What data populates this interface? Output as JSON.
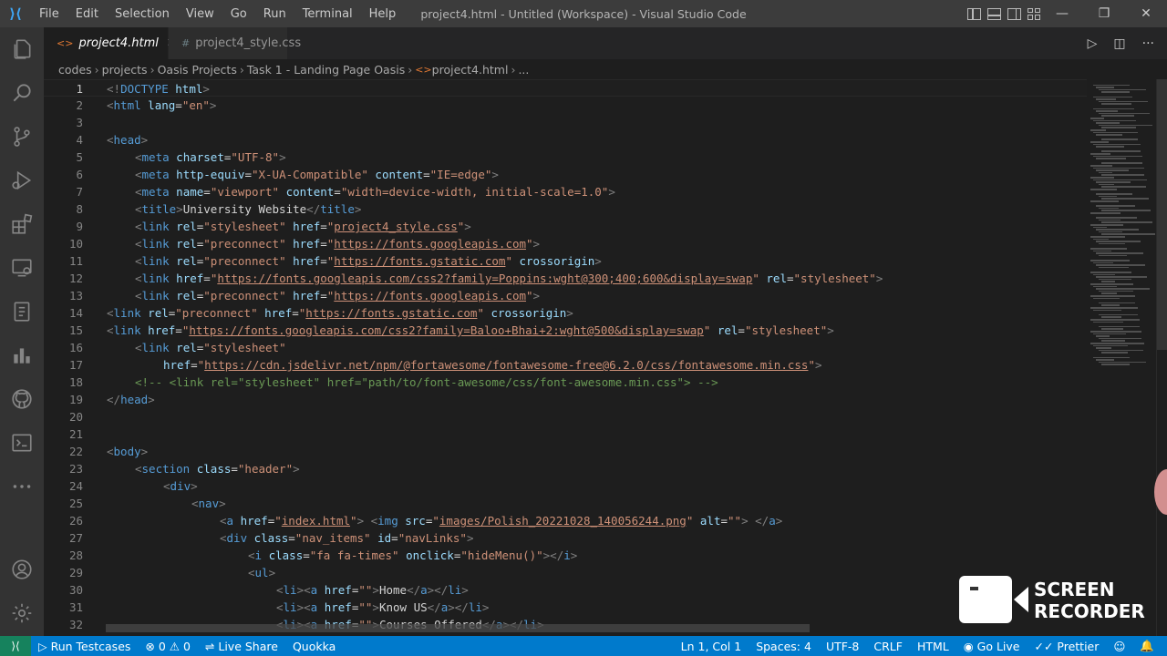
{
  "window": {
    "title": "project4.html - Untitled (Workspace) - Visual Studio Code",
    "menu": [
      "File",
      "Edit",
      "Selection",
      "View",
      "Go",
      "Run",
      "Terminal",
      "Help"
    ]
  },
  "tabs": [
    {
      "label": "project4.html",
      "icon": "<>",
      "active": true
    },
    {
      "label": "project4_style.css",
      "icon": "#",
      "active": false
    }
  ],
  "breadcrumb": [
    "codes",
    "projects",
    "Oasis Projects",
    "Task 1 - Landing Page Oasis",
    "project4.html",
    "..."
  ],
  "editor": {
    "current_line": 1,
    "lines": [
      {
        "n": "1",
        "indent": 0,
        "t": [
          [
            "p",
            "<!"
          ],
          [
            "g",
            "DOCTYPE"
          ],
          [
            "a",
            " html"
          ],
          [
            "p",
            ">"
          ]
        ]
      },
      {
        "n": "2",
        "indent": 0,
        "t": [
          [
            "p",
            "<"
          ],
          [
            "g",
            "html"
          ],
          [
            "a",
            " lang"
          ],
          [
            "x",
            "="
          ],
          [
            "s",
            "\"en\""
          ],
          [
            "p",
            ">"
          ]
        ]
      },
      {
        "n": "3",
        "indent": 0,
        "t": []
      },
      {
        "n": "4",
        "indent": 0,
        "t": [
          [
            "p",
            "<"
          ],
          [
            "g",
            "head"
          ],
          [
            "p",
            ">"
          ]
        ]
      },
      {
        "n": "5",
        "indent": 1,
        "t": [
          [
            "p",
            "<"
          ],
          [
            "g",
            "meta"
          ],
          [
            "a",
            " charset"
          ],
          [
            "x",
            "="
          ],
          [
            "s",
            "\"UTF-8\""
          ],
          [
            "p",
            ">"
          ]
        ]
      },
      {
        "n": "6",
        "indent": 1,
        "t": [
          [
            "p",
            "<"
          ],
          [
            "g",
            "meta"
          ],
          [
            "a",
            " http-equiv"
          ],
          [
            "x",
            "="
          ],
          [
            "s",
            "\"X-UA-Compatible\""
          ],
          [
            "a",
            " content"
          ],
          [
            "x",
            "="
          ],
          [
            "s",
            "\"IE=edge\""
          ],
          [
            "p",
            ">"
          ]
        ]
      },
      {
        "n": "7",
        "indent": 1,
        "t": [
          [
            "p",
            "<"
          ],
          [
            "g",
            "meta"
          ],
          [
            "a",
            " name"
          ],
          [
            "x",
            "="
          ],
          [
            "s",
            "\"viewport\""
          ],
          [
            "a",
            " content"
          ],
          [
            "x",
            "="
          ],
          [
            "s",
            "\"width=device-width, initial-scale=1.0\""
          ],
          [
            "p",
            ">"
          ]
        ]
      },
      {
        "n": "8",
        "indent": 1,
        "t": [
          [
            "p",
            "<"
          ],
          [
            "g",
            "title"
          ],
          [
            "p",
            ">"
          ],
          [
            "x",
            "University Website"
          ],
          [
            "p",
            "</"
          ],
          [
            "g",
            "title"
          ],
          [
            "p",
            ">"
          ]
        ]
      },
      {
        "n": "9",
        "indent": 1,
        "t": [
          [
            "p",
            "<"
          ],
          [
            "g",
            "link"
          ],
          [
            "a",
            " rel"
          ],
          [
            "x",
            "="
          ],
          [
            "s",
            "\"stylesheet\""
          ],
          [
            "a",
            " href"
          ],
          [
            "x",
            "="
          ],
          [
            "s",
            "\""
          ],
          [
            "l",
            "project4_style.css"
          ],
          [
            "s",
            "\""
          ],
          [
            "p",
            ">"
          ]
        ]
      },
      {
        "n": "10",
        "indent": 1,
        "t": [
          [
            "p",
            "<"
          ],
          [
            "g",
            "link"
          ],
          [
            "a",
            " rel"
          ],
          [
            "x",
            "="
          ],
          [
            "s",
            "\"preconnect\""
          ],
          [
            "a",
            " href"
          ],
          [
            "x",
            "="
          ],
          [
            "s",
            "\""
          ],
          [
            "l",
            "https://fonts.googleapis.com"
          ],
          [
            "s",
            "\""
          ],
          [
            "p",
            ">"
          ]
        ]
      },
      {
        "n": "11",
        "indent": 1,
        "t": [
          [
            "p",
            "<"
          ],
          [
            "g",
            "link"
          ],
          [
            "a",
            " rel"
          ],
          [
            "x",
            "="
          ],
          [
            "s",
            "\"preconnect\""
          ],
          [
            "a",
            " href"
          ],
          [
            "x",
            "="
          ],
          [
            "s",
            "\""
          ],
          [
            "l",
            "https://fonts.gstatic.com"
          ],
          [
            "s",
            "\""
          ],
          [
            "a",
            " crossorigin"
          ],
          [
            "p",
            ">"
          ]
        ]
      },
      {
        "n": "12",
        "indent": 1,
        "t": [
          [
            "p",
            "<"
          ],
          [
            "g",
            "link"
          ],
          [
            "a",
            " href"
          ],
          [
            "x",
            "="
          ],
          [
            "s",
            "\""
          ],
          [
            "l",
            "https://fonts.googleapis.com/css2?family=Poppins:wght@300;400;600&display=swap"
          ],
          [
            "s",
            "\""
          ],
          [
            "a",
            " rel"
          ],
          [
            "x",
            "="
          ],
          [
            "s",
            "\"stylesheet\""
          ],
          [
            "p",
            ">"
          ]
        ]
      },
      {
        "n": "13",
        "indent": 1,
        "t": [
          [
            "p",
            "<"
          ],
          [
            "g",
            "link"
          ],
          [
            "a",
            " rel"
          ],
          [
            "x",
            "="
          ],
          [
            "s",
            "\"preconnect\""
          ],
          [
            "a",
            " href"
          ],
          [
            "x",
            "="
          ],
          [
            "s",
            "\""
          ],
          [
            "l",
            "https://fonts.googleapis.com"
          ],
          [
            "s",
            "\""
          ],
          [
            "p",
            ">"
          ]
        ]
      },
      {
        "n": "14",
        "indent": 0,
        "t": [
          [
            "p",
            "<"
          ],
          [
            "g",
            "link"
          ],
          [
            "a",
            " rel"
          ],
          [
            "x",
            "="
          ],
          [
            "s",
            "\"preconnect\""
          ],
          [
            "a",
            " href"
          ],
          [
            "x",
            "="
          ],
          [
            "s",
            "\""
          ],
          [
            "l",
            "https://fonts.gstatic.com"
          ],
          [
            "s",
            "\""
          ],
          [
            "a",
            " crossorigin"
          ],
          [
            "p",
            ">"
          ]
        ]
      },
      {
        "n": "15",
        "indent": 0,
        "t": [
          [
            "p",
            "<"
          ],
          [
            "g",
            "link"
          ],
          [
            "a",
            " href"
          ],
          [
            "x",
            "="
          ],
          [
            "s",
            "\""
          ],
          [
            "l",
            "https://fonts.googleapis.com/css2?family=Baloo+Bhai+2:wght@500&display=swap"
          ],
          [
            "s",
            "\""
          ],
          [
            "a",
            " rel"
          ],
          [
            "x",
            "="
          ],
          [
            "s",
            "\"stylesheet\""
          ],
          [
            "p",
            ">"
          ]
        ]
      },
      {
        "n": "16",
        "indent": 1,
        "t": [
          [
            "p",
            "<"
          ],
          [
            "g",
            "link"
          ],
          [
            "a",
            " rel"
          ],
          [
            "x",
            "="
          ],
          [
            "s",
            "\"stylesheet\""
          ]
        ]
      },
      {
        "n": "17",
        "indent": 2,
        "t": [
          [
            "a",
            "href"
          ],
          [
            "x",
            "="
          ],
          [
            "s",
            "\""
          ],
          [
            "l",
            "https://cdn.jsdelivr.net/npm/@fortawesome/fontawesome-free@6.2.0/css/fontawesome.min.css"
          ],
          [
            "s",
            "\""
          ],
          [
            "p",
            ">"
          ]
        ]
      },
      {
        "n": "18",
        "indent": 1,
        "t": [
          [
            "c",
            "<!-- <link rel=\"stylesheet\" href=\"path/to/font-awesome/css/font-awesome.min.css\"> -->"
          ]
        ]
      },
      {
        "n": "19",
        "indent": 0,
        "t": [
          [
            "p",
            "</"
          ],
          [
            "g",
            "head"
          ],
          [
            "p",
            ">"
          ]
        ]
      },
      {
        "n": "20",
        "indent": 0,
        "t": []
      },
      {
        "n": "21",
        "indent": 0,
        "t": []
      },
      {
        "n": "22",
        "indent": 0,
        "t": [
          [
            "p",
            "<"
          ],
          [
            "g",
            "body"
          ],
          [
            "p",
            ">"
          ]
        ]
      },
      {
        "n": "23",
        "indent": 1,
        "t": [
          [
            "p",
            "<"
          ],
          [
            "g",
            "section"
          ],
          [
            "a",
            " class"
          ],
          [
            "x",
            "="
          ],
          [
            "s",
            "\"header\""
          ],
          [
            "p",
            ">"
          ]
        ]
      },
      {
        "n": "24",
        "indent": 2,
        "t": [
          [
            "p",
            "<"
          ],
          [
            "g",
            "div"
          ],
          [
            "p",
            ">"
          ]
        ]
      },
      {
        "n": "25",
        "indent": 3,
        "t": [
          [
            "p",
            "<"
          ],
          [
            "g",
            "nav"
          ],
          [
            "p",
            ">"
          ]
        ]
      },
      {
        "n": "26",
        "indent": 4,
        "t": [
          [
            "p",
            "<"
          ],
          [
            "g",
            "a"
          ],
          [
            "a",
            " href"
          ],
          [
            "x",
            "="
          ],
          [
            "s",
            "\""
          ],
          [
            "l",
            "index.html"
          ],
          [
            "s",
            "\""
          ],
          [
            "p",
            ">"
          ],
          [
            "x",
            " "
          ],
          [
            "p",
            "<"
          ],
          [
            "g",
            "img"
          ],
          [
            "a",
            " src"
          ],
          [
            "x",
            "="
          ],
          [
            "s",
            "\""
          ],
          [
            "l",
            "images/Polish_20221028_140056244.png"
          ],
          [
            "s",
            "\""
          ],
          [
            "a",
            " alt"
          ],
          [
            "x",
            "="
          ],
          [
            "s",
            "\"\""
          ],
          [
            "p",
            ">"
          ],
          [
            "x",
            " "
          ],
          [
            "p",
            "</"
          ],
          [
            "g",
            "a"
          ],
          [
            "p",
            ">"
          ]
        ]
      },
      {
        "n": "27",
        "indent": 4,
        "t": [
          [
            "p",
            "<"
          ],
          [
            "g",
            "div"
          ],
          [
            "a",
            " class"
          ],
          [
            "x",
            "="
          ],
          [
            "s",
            "\"nav_items\""
          ],
          [
            "a",
            " id"
          ],
          [
            "x",
            "="
          ],
          [
            "s",
            "\"navLinks\""
          ],
          [
            "p",
            ">"
          ]
        ]
      },
      {
        "n": "28",
        "indent": 5,
        "t": [
          [
            "p",
            "<"
          ],
          [
            "g",
            "i"
          ],
          [
            "a",
            " class"
          ],
          [
            "x",
            "="
          ],
          [
            "s",
            "\"fa fa-times\""
          ],
          [
            "a",
            " onclick"
          ],
          [
            "x",
            "="
          ],
          [
            "s",
            "\"hideMenu()\""
          ],
          [
            "p",
            "></"
          ],
          [
            "g",
            "i"
          ],
          [
            "p",
            ">"
          ]
        ]
      },
      {
        "n": "29",
        "indent": 5,
        "t": [
          [
            "p",
            "<"
          ],
          [
            "g",
            "ul"
          ],
          [
            "p",
            ">"
          ]
        ]
      },
      {
        "n": "30",
        "indent": 6,
        "t": [
          [
            "p",
            "<"
          ],
          [
            "g",
            "li"
          ],
          [
            "p",
            "><"
          ],
          [
            "g",
            "a"
          ],
          [
            "a",
            " href"
          ],
          [
            "x",
            "="
          ],
          [
            "s",
            "\"\""
          ],
          [
            "p",
            ">"
          ],
          [
            "x",
            "Home"
          ],
          [
            "p",
            "</"
          ],
          [
            "g",
            "a"
          ],
          [
            "p",
            "></"
          ],
          [
            "g",
            "li"
          ],
          [
            "p",
            ">"
          ]
        ]
      },
      {
        "n": "31",
        "indent": 6,
        "t": [
          [
            "p",
            "<"
          ],
          [
            "g",
            "li"
          ],
          [
            "p",
            "><"
          ],
          [
            "g",
            "a"
          ],
          [
            "a",
            " href"
          ],
          [
            "x",
            "="
          ],
          [
            "s",
            "\"\""
          ],
          [
            "p",
            ">"
          ],
          [
            "x",
            "Know US"
          ],
          [
            "p",
            "</"
          ],
          [
            "g",
            "a"
          ],
          [
            "p",
            "></"
          ],
          [
            "g",
            "li"
          ],
          [
            "p",
            ">"
          ]
        ]
      },
      {
        "n": "32",
        "indent": 6,
        "t": [
          [
            "p",
            "<"
          ],
          [
            "g",
            "li"
          ],
          [
            "p",
            "><"
          ],
          [
            "g",
            "a"
          ],
          [
            "a",
            " href"
          ],
          [
            "x",
            "="
          ],
          [
            "s",
            "\"\""
          ],
          [
            "p",
            ">"
          ],
          [
            "x",
            "Courses Offered"
          ],
          [
            "p",
            "</"
          ],
          [
            "g",
            "a"
          ],
          [
            "p",
            "></"
          ],
          [
            "g",
            "li"
          ],
          [
            "p",
            ">"
          ]
        ]
      }
    ]
  },
  "watermark": {
    "line1": "SCREEN",
    "line2": "RECORDER"
  },
  "statusbar": {
    "left": [
      {
        "name": "run-testcases-button",
        "label": "▷ Run Testcases"
      },
      {
        "name": "problems-indicator",
        "label": "⊗ 0 ⚠ 0"
      },
      {
        "name": "live-share-button",
        "label": "⇌ Live Share"
      },
      {
        "name": "quokka-button",
        "label": "Quokka"
      }
    ],
    "right": [
      {
        "name": "cursor-position",
        "label": "Ln 1, Col 1"
      },
      {
        "name": "indentation-setting",
        "label": "Spaces: 4"
      },
      {
        "name": "encoding-setting",
        "label": "UTF-8"
      },
      {
        "name": "eol-setting",
        "label": "CRLF"
      },
      {
        "name": "language-mode",
        "label": "HTML"
      },
      {
        "name": "go-live-button",
        "label": "◉ Go Live"
      },
      {
        "name": "prettier-button",
        "label": "✓✓ Prettier"
      },
      {
        "name": "feedback-icon",
        "label": "☺"
      },
      {
        "name": "notifications-icon",
        "label": "🔔"
      }
    ]
  },
  "icons": {
    "activity_bar": [
      "explorer-icon",
      "search-icon",
      "source-control-icon",
      "run-debug-icon",
      "extensions-icon",
      "remote-explorer-icon",
      "testing-icon",
      "charts-icon",
      "github-icon",
      "terminal-icon",
      "more-icon",
      "account-icon",
      "settings-gear-icon"
    ]
  },
  "colors": {
    "statusbar": "#007acc",
    "tag": "#569cd6",
    "attribute": "#9cdcfe",
    "string": "#ce9178",
    "comment": "#6a9955"
  }
}
